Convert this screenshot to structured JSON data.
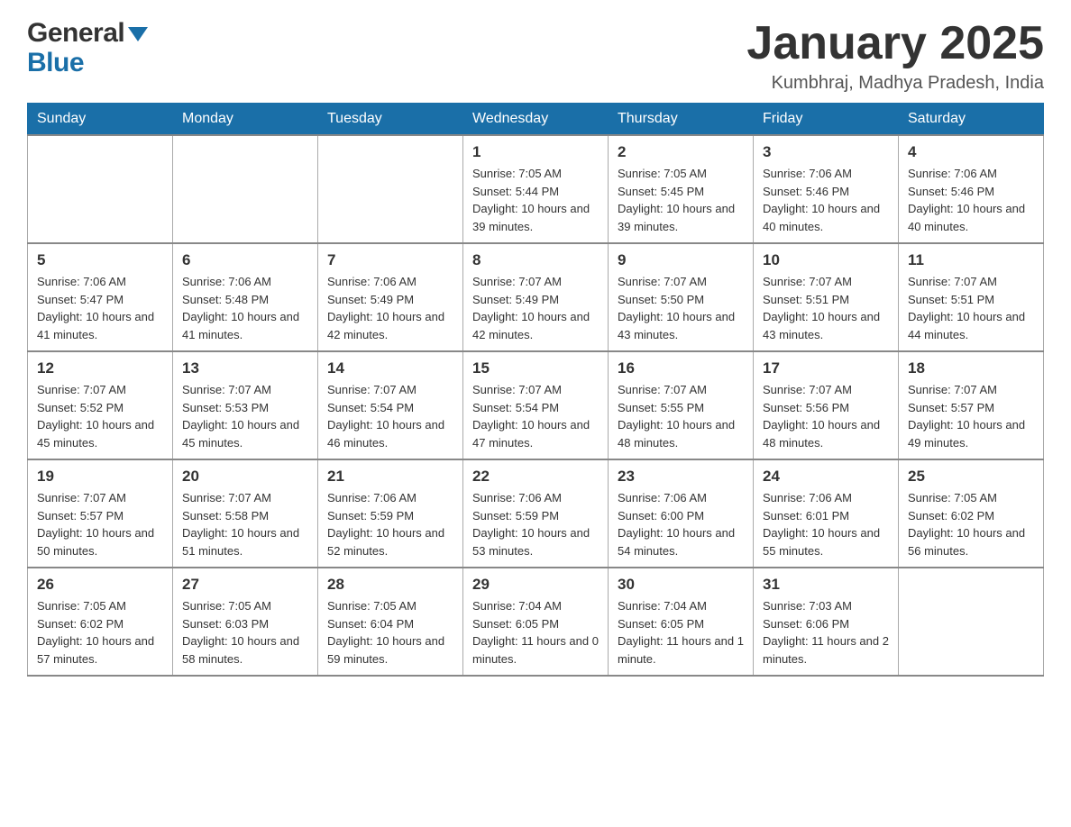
{
  "header": {
    "logo_general": "General",
    "logo_blue": "Blue",
    "month_title": "January 2025",
    "location": "Kumbhraj, Madhya Pradesh, India"
  },
  "days_of_week": [
    "Sunday",
    "Monday",
    "Tuesday",
    "Wednesday",
    "Thursday",
    "Friday",
    "Saturday"
  ],
  "weeks": [
    [
      {
        "day": "",
        "info": ""
      },
      {
        "day": "",
        "info": ""
      },
      {
        "day": "",
        "info": ""
      },
      {
        "day": "1",
        "info": "Sunrise: 7:05 AM\nSunset: 5:44 PM\nDaylight: 10 hours and 39 minutes."
      },
      {
        "day": "2",
        "info": "Sunrise: 7:05 AM\nSunset: 5:45 PM\nDaylight: 10 hours and 39 minutes."
      },
      {
        "day": "3",
        "info": "Sunrise: 7:06 AM\nSunset: 5:46 PM\nDaylight: 10 hours and 40 minutes."
      },
      {
        "day": "4",
        "info": "Sunrise: 7:06 AM\nSunset: 5:46 PM\nDaylight: 10 hours and 40 minutes."
      }
    ],
    [
      {
        "day": "5",
        "info": "Sunrise: 7:06 AM\nSunset: 5:47 PM\nDaylight: 10 hours and 41 minutes."
      },
      {
        "day": "6",
        "info": "Sunrise: 7:06 AM\nSunset: 5:48 PM\nDaylight: 10 hours and 41 minutes."
      },
      {
        "day": "7",
        "info": "Sunrise: 7:06 AM\nSunset: 5:49 PM\nDaylight: 10 hours and 42 minutes."
      },
      {
        "day": "8",
        "info": "Sunrise: 7:07 AM\nSunset: 5:49 PM\nDaylight: 10 hours and 42 minutes."
      },
      {
        "day": "9",
        "info": "Sunrise: 7:07 AM\nSunset: 5:50 PM\nDaylight: 10 hours and 43 minutes."
      },
      {
        "day": "10",
        "info": "Sunrise: 7:07 AM\nSunset: 5:51 PM\nDaylight: 10 hours and 43 minutes."
      },
      {
        "day": "11",
        "info": "Sunrise: 7:07 AM\nSunset: 5:51 PM\nDaylight: 10 hours and 44 minutes."
      }
    ],
    [
      {
        "day": "12",
        "info": "Sunrise: 7:07 AM\nSunset: 5:52 PM\nDaylight: 10 hours and 45 minutes."
      },
      {
        "day": "13",
        "info": "Sunrise: 7:07 AM\nSunset: 5:53 PM\nDaylight: 10 hours and 45 minutes."
      },
      {
        "day": "14",
        "info": "Sunrise: 7:07 AM\nSunset: 5:54 PM\nDaylight: 10 hours and 46 minutes."
      },
      {
        "day": "15",
        "info": "Sunrise: 7:07 AM\nSunset: 5:54 PM\nDaylight: 10 hours and 47 minutes."
      },
      {
        "day": "16",
        "info": "Sunrise: 7:07 AM\nSunset: 5:55 PM\nDaylight: 10 hours and 48 minutes."
      },
      {
        "day": "17",
        "info": "Sunrise: 7:07 AM\nSunset: 5:56 PM\nDaylight: 10 hours and 48 minutes."
      },
      {
        "day": "18",
        "info": "Sunrise: 7:07 AM\nSunset: 5:57 PM\nDaylight: 10 hours and 49 minutes."
      }
    ],
    [
      {
        "day": "19",
        "info": "Sunrise: 7:07 AM\nSunset: 5:57 PM\nDaylight: 10 hours and 50 minutes."
      },
      {
        "day": "20",
        "info": "Sunrise: 7:07 AM\nSunset: 5:58 PM\nDaylight: 10 hours and 51 minutes."
      },
      {
        "day": "21",
        "info": "Sunrise: 7:06 AM\nSunset: 5:59 PM\nDaylight: 10 hours and 52 minutes."
      },
      {
        "day": "22",
        "info": "Sunrise: 7:06 AM\nSunset: 5:59 PM\nDaylight: 10 hours and 53 minutes."
      },
      {
        "day": "23",
        "info": "Sunrise: 7:06 AM\nSunset: 6:00 PM\nDaylight: 10 hours and 54 minutes."
      },
      {
        "day": "24",
        "info": "Sunrise: 7:06 AM\nSunset: 6:01 PM\nDaylight: 10 hours and 55 minutes."
      },
      {
        "day": "25",
        "info": "Sunrise: 7:05 AM\nSunset: 6:02 PM\nDaylight: 10 hours and 56 minutes."
      }
    ],
    [
      {
        "day": "26",
        "info": "Sunrise: 7:05 AM\nSunset: 6:02 PM\nDaylight: 10 hours and 57 minutes."
      },
      {
        "day": "27",
        "info": "Sunrise: 7:05 AM\nSunset: 6:03 PM\nDaylight: 10 hours and 58 minutes."
      },
      {
        "day": "28",
        "info": "Sunrise: 7:05 AM\nSunset: 6:04 PM\nDaylight: 10 hours and 59 minutes."
      },
      {
        "day": "29",
        "info": "Sunrise: 7:04 AM\nSunset: 6:05 PM\nDaylight: 11 hours and 0 minutes."
      },
      {
        "day": "30",
        "info": "Sunrise: 7:04 AM\nSunset: 6:05 PM\nDaylight: 11 hours and 1 minute."
      },
      {
        "day": "31",
        "info": "Sunrise: 7:03 AM\nSunset: 6:06 PM\nDaylight: 11 hours and 2 minutes."
      },
      {
        "day": "",
        "info": ""
      }
    ]
  ]
}
